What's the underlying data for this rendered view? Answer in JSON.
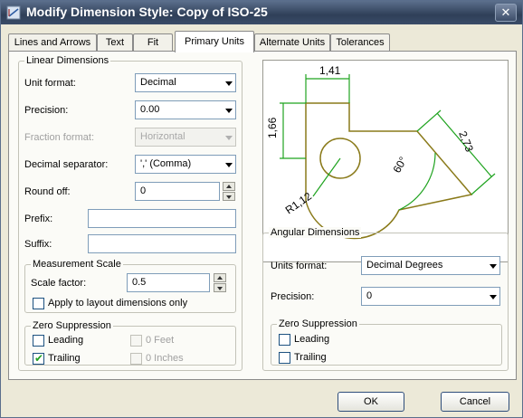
{
  "window": {
    "title": "Modify Dimension Style: Copy of ISO-25",
    "close_glyph": "✕"
  },
  "tabs": [
    {
      "label": "Lines and Arrows"
    },
    {
      "label": "Text"
    },
    {
      "label": "Fit"
    },
    {
      "label": "Primary Units"
    },
    {
      "label": "Alternate Units"
    },
    {
      "label": "Tolerances"
    }
  ],
  "active_tab": "Primary Units",
  "linear": {
    "group_title": "Linear Dimensions",
    "unit_format": {
      "label": "Unit format:",
      "value": "Decimal"
    },
    "precision": {
      "label": "Precision:",
      "value": "0.00"
    },
    "fraction_format": {
      "label": "Fraction format:",
      "value": "Horizontal",
      "enabled": false
    },
    "decimal_separator": {
      "label": "Decimal separator:",
      "value": "',' (Comma)"
    },
    "round_off": {
      "label": "Round off:",
      "value": "0"
    },
    "prefix": {
      "label": "Prefix:",
      "value": ""
    },
    "suffix": {
      "label": "Suffix:",
      "value": ""
    },
    "measurement_scale": {
      "group_title": "Measurement Scale",
      "scale_factor": {
        "label": "Scale factor:",
        "value": "0.5"
      },
      "apply_layout": {
        "label": "Apply to layout dimensions only",
        "checked": false
      }
    },
    "zero_suppression": {
      "group_title": "Zero Suppression",
      "leading": {
        "label": "Leading",
        "checked": false
      },
      "trailing": {
        "label": "Trailing",
        "checked": true
      },
      "feet": {
        "label": "0 Feet",
        "checked": false,
        "enabled": false
      },
      "inches": {
        "label": "0 Inches",
        "checked": false,
        "enabled": false
      }
    }
  },
  "preview": {
    "dim_top": "1,41",
    "dim_left": "1,66",
    "dim_right": "2,73",
    "dim_angle": "60°",
    "dim_radius": "R1,12",
    "colors": {
      "geometry": "#8a7a1a",
      "dimension": "#1fa31f",
      "text": "#000000"
    }
  },
  "angular": {
    "group_title": "Angular Dimensions",
    "units_format": {
      "label": "Units format:",
      "value": "Decimal Degrees"
    },
    "precision": {
      "label": "Precision:",
      "value": "0"
    },
    "zero_suppression": {
      "group_title": "Zero Suppression",
      "leading": {
        "label": "Leading",
        "checked": false
      },
      "trailing": {
        "label": "Trailing",
        "checked": false
      }
    }
  },
  "buttons": {
    "ok": "OK",
    "cancel": "Cancel"
  },
  "check_glyph": "✔"
}
